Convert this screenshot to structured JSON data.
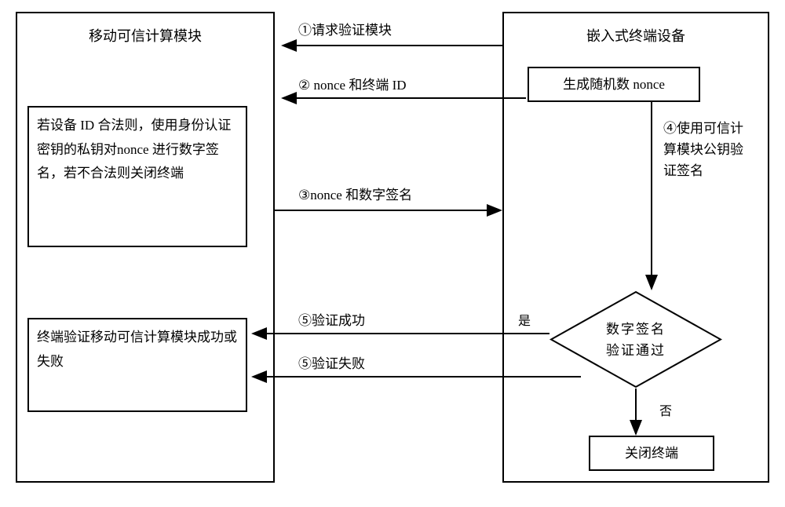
{
  "left": {
    "title": "移动可信计算模块",
    "box1": "若设备 ID 合法则，使用身份认证密钥的私钥对nonce 进行数字签名，若不合法则关闭终端",
    "box2": "终端验证移动可信计算模块成功或失败"
  },
  "right": {
    "title": "嵌入式终端设备",
    "nonceBox": "生成随机数 nonce",
    "step4_line1": "④使用可信计",
    "step4_line2": "算模块公钥验",
    "step4_line3": "证签名",
    "diamond_line1": "数字签名",
    "diamond_line2": "验证通过",
    "yes": "是",
    "no": "否",
    "closeBox": "关闭终端"
  },
  "arrows": {
    "step1": "①请求验证模块",
    "step2": "② nonce 和终端 ID",
    "step3": "③nonce 和数字签名",
    "step5_success": "⑤验证成功",
    "step5_fail": "⑤验证失败"
  }
}
